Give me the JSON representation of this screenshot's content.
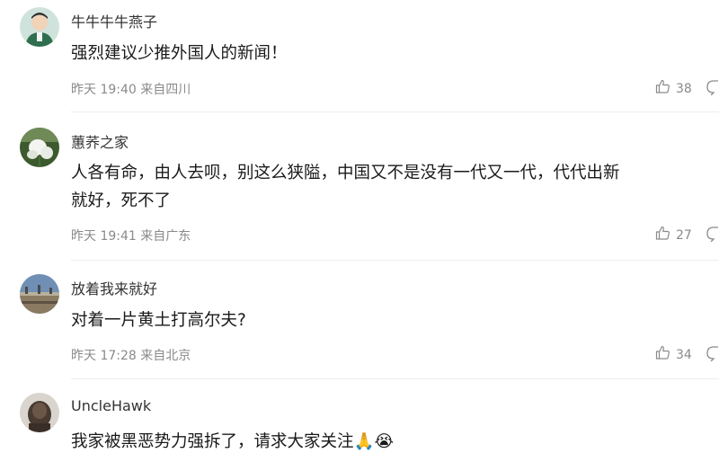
{
  "comments": [
    {
      "username": "牛牛牛牛燕子",
      "text_lines": [
        "强烈建议少推外国人的新闻！"
      ],
      "time": "昨天 19:40",
      "location": "来自四川",
      "likes": "38",
      "avatar": "person-avatar"
    },
    {
      "username": "蕙荞之家",
      "text_lines": [
        "人各有命，由人去呗，别这么狭隘，中国又不是没有一代又一代，代代出新",
        "就好，死不了"
      ],
      "time": "昨天 19:41",
      "location": "来自广东",
      "likes": "27",
      "avatar": "flower-avatar"
    },
    {
      "username": "放着我来就好",
      "text_lines": [
        "对着一片黄土打高尔夫?"
      ],
      "time": "昨天 17:28",
      "location": "来自北京",
      "likes": "34",
      "avatar": "landscape-avatar"
    },
    {
      "username": "UncleHawk",
      "text_lines": [
        "我家被黑恶势力强拆了，请求大家关注🙏😭"
      ],
      "avatar": "dark-avatar"
    }
  ],
  "icons": {
    "like": "thumbs-up-icon",
    "reply": "speech-bubble-icon"
  }
}
